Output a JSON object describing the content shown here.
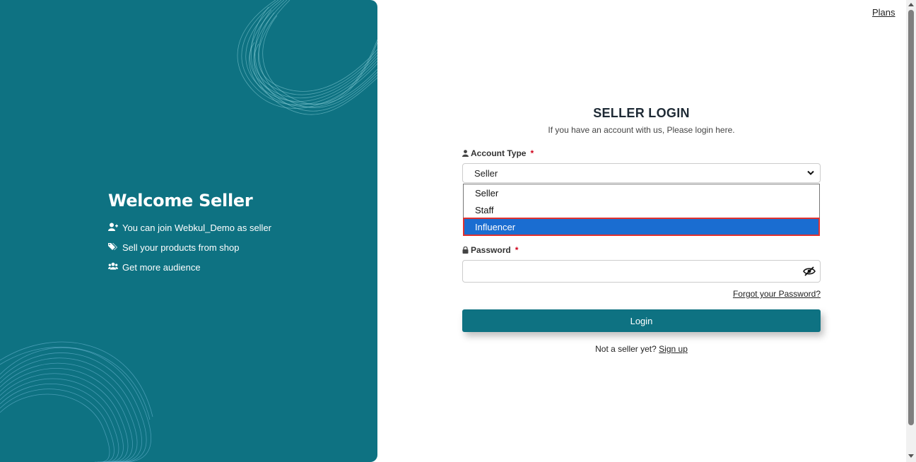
{
  "top_nav": {
    "plans_link": "Plans"
  },
  "welcome": {
    "heading": "Welcome Seller",
    "features": [
      {
        "icon": "user-plus-icon",
        "text": "You can join Webkul_Demo as seller"
      },
      {
        "icon": "tags-icon",
        "text": "Sell your products from shop"
      },
      {
        "icon": "users-icon",
        "text": "Get more audience"
      }
    ]
  },
  "form": {
    "title": "SELLER LOGIN",
    "subtitle": "If you have an account with us, Please login here.",
    "account_type_label": "Account Type",
    "required_mark": "*",
    "account_type_value": "Seller",
    "options": [
      "Seller",
      "Staff",
      "Influencer"
    ],
    "highlighted_option": "Influencer",
    "password_label": "Password",
    "forgot_password": "Forgot your Password?",
    "login_button": "Login",
    "not_seller_text": "Not a seller yet?",
    "signup_link": "Sign up"
  },
  "colors": {
    "brand_teal": "#0e7282",
    "dropdown_highlight": "#1a6dd1",
    "required_red": "#d0021b"
  }
}
